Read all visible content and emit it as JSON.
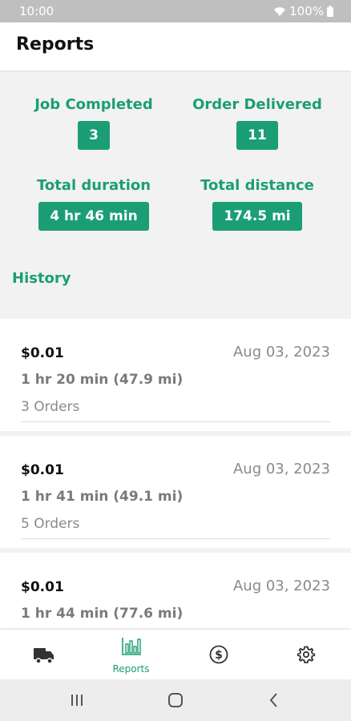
{
  "status_bar": {
    "time": "10:00",
    "battery": "100%"
  },
  "app_bar": {
    "title": "Reports"
  },
  "stats": {
    "job_completed": {
      "label": "Job Completed",
      "value": "3"
    },
    "order_delivered": {
      "label": "Order Delivered",
      "value": "11"
    },
    "total_duration": {
      "label": "Total duration",
      "value": "4 hr 46 min"
    },
    "total_distance": {
      "label": "Total distance",
      "value": "174.5 mi"
    }
  },
  "history": {
    "title": "History",
    "items": [
      {
        "amount": "$0.01",
        "date": "Aug 03, 2023",
        "duration": "1 hr 20 min (47.9 mi)",
        "orders": "3 Orders"
      },
      {
        "amount": "$0.01",
        "date": "Aug 03, 2023",
        "duration": "1 hr 41 min (49.1 mi)",
        "orders": "5 Orders"
      },
      {
        "amount": "$0.01",
        "date": "Aug 03, 2023",
        "duration": "1 hr 44 min (77.6 mi)",
        "orders": ""
      }
    ]
  },
  "bottom_nav": {
    "active": "reports",
    "reports_label": "Reports",
    "accent": "#1b9e75",
    "icons": [
      "truck-icon",
      "bar-chart-icon",
      "dollar-icon",
      "gear-icon"
    ]
  },
  "system_nav": {
    "icons": [
      "recents-icon",
      "home-icon",
      "back-icon"
    ]
  }
}
